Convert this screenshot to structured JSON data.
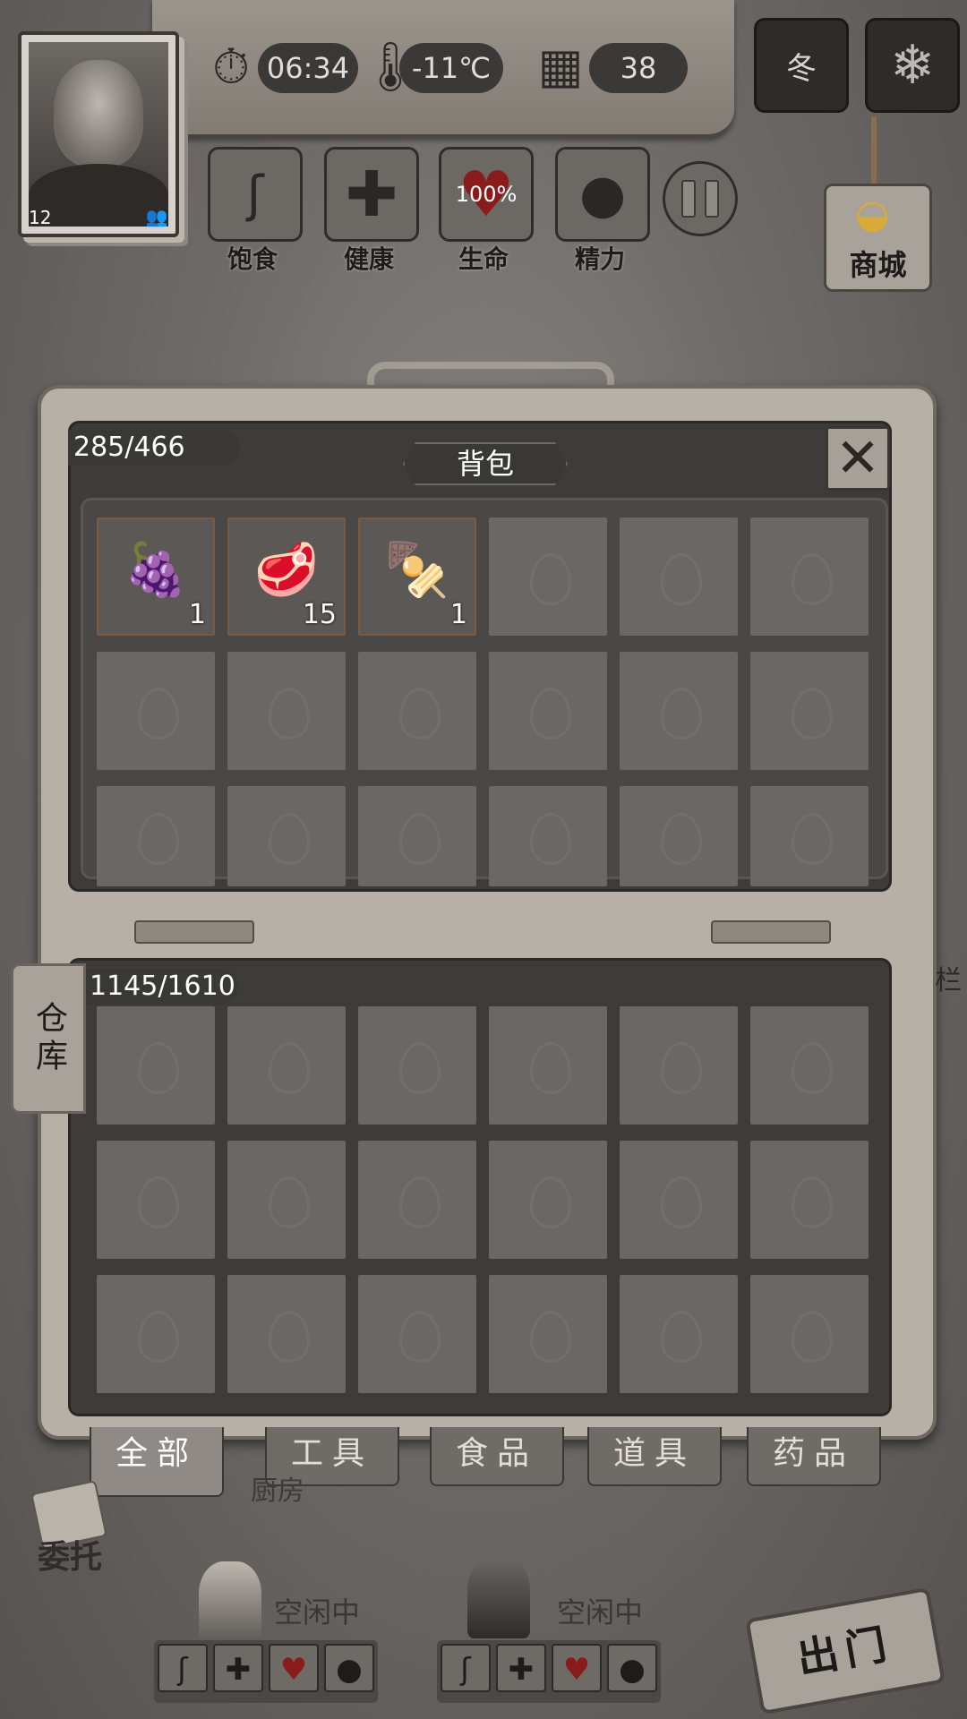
{
  "hud": {
    "portrait_level": "12",
    "time": "06:34",
    "temperature": "-11℃",
    "day": "38",
    "season_label": "冬"
  },
  "stats": [
    {
      "label": "饱食",
      "icon": "stomach-icon"
    },
    {
      "label": "健康",
      "icon": "cross-icon"
    },
    {
      "label": "生命",
      "icon": "heart-icon",
      "value": "100%"
    },
    {
      "label": "精力",
      "icon": "person-icon"
    }
  ],
  "shop": {
    "label": "商城"
  },
  "backpack": {
    "title": "背包",
    "capacity": "285/466",
    "items": [
      {
        "icon": "berries-icon",
        "qty": "1"
      },
      {
        "icon": "grilled-meat-icon",
        "qty": "15"
      },
      {
        "icon": "mushroom-skewer-icon",
        "qty": "1"
      }
    ],
    "total_slots": 18
  },
  "storage": {
    "side_tab": "仓库",
    "capacity": "1145/1610",
    "total_slots": 18
  },
  "tabs": [
    "全部",
    "工具",
    "食品",
    "道具",
    "药品"
  ],
  "active_tab": 0,
  "scene": {
    "quest_label": "委托",
    "kitchen_label": "厨房",
    "survivor1_status": "空闲中",
    "survivor2_status": "空闲中",
    "exit_label": "出门",
    "fence_label": "栏"
  },
  "colors": {
    "heart": "#8a1b1b",
    "shell": "#d9a93a"
  }
}
